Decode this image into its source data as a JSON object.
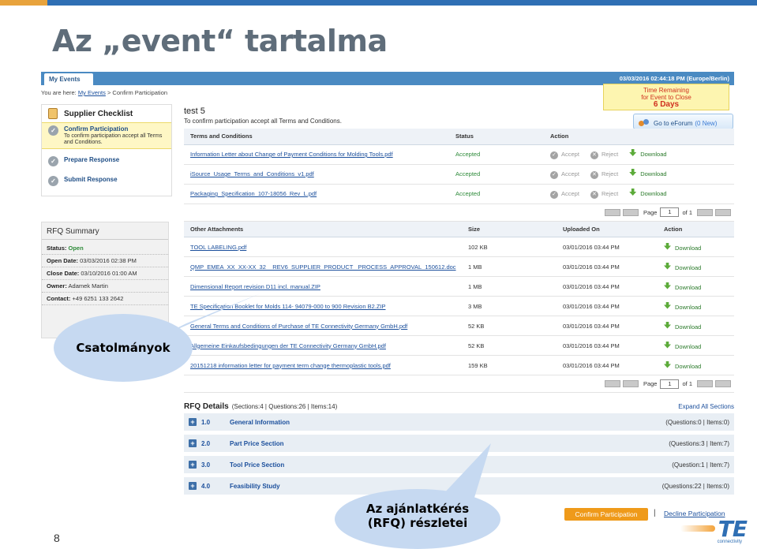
{
  "slide": {
    "title": "Az „event“ tartalma",
    "page_number": "8"
  },
  "nav": {
    "tab": "My Events",
    "datetime": "03/03/2016 02:44:18 PM (Europe/Berlin)"
  },
  "breadcrumb": {
    "prefix": "You are here:",
    "link": "My Events",
    "current": "> Confirm Participation"
  },
  "time_remaining": {
    "line1": "Time Remaining",
    "line2": "for Event to Close",
    "days": "6 Days"
  },
  "eforum": {
    "label": "Go to eForum",
    "count": "(0 New)"
  },
  "checklist": {
    "title": "Supplier Checklist",
    "items": [
      {
        "label": "Confirm Participation",
        "desc": "To confirm participation accept all Terms and Conditions."
      },
      {
        "label": "Prepare Response"
      },
      {
        "label": "Submit Response"
      }
    ]
  },
  "rfq_summary": {
    "title": "RFQ Summary",
    "status_label": "Status:",
    "status_value": "Open",
    "open_label": "Open Date:",
    "open_value": "03/03/2016 02:38 PM",
    "close_label": "Close Date:",
    "close_value": "03/10/2016 01:00 AM",
    "owner_label": "Owner:",
    "owner_value": "Adamek Martin",
    "contact_label": "Contact:",
    "contact_value": "+49 6251 133 2642"
  },
  "event": {
    "title": "test 5",
    "subtitle": "To confirm participation accept all Terms and Conditions."
  },
  "terms_table": {
    "headers": [
      "Terms and Conditions",
      "Status",
      "Action"
    ],
    "rows": [
      {
        "name": "Information Letter about Change of Payment Conditions for Molding Tools.pdf",
        "status": "Accepted"
      },
      {
        "name": "iSource_Usage_Terms_and_Conditions_v1.pdf",
        "status": "Accepted"
      },
      {
        "name": "Packaging_Specification_107-18056_Rev_L.pdf",
        "status": "Accepted"
      }
    ],
    "accept": "Accept",
    "reject": "Reject",
    "download": "Download"
  },
  "pager": {
    "label": "Page",
    "value": "1",
    "of": "of 1"
  },
  "attachments": {
    "headers": [
      "Other Attachments",
      "Size",
      "Uploaded On",
      "Action"
    ],
    "rows": [
      {
        "name": "TOOL LABELING.pdf",
        "size": "102 KB",
        "date": "03/01/2016 03:44 PM"
      },
      {
        "name": "QMP_EMEA_XX_XX-XX_32__REV6_SUPPLIER_PRODUCT _PROCESS_APPROVAL_150612.doc",
        "size": "1 MB",
        "date": "03/01/2016 03:44 PM"
      },
      {
        "name": "Dimensional Report revision D11 incl. manual.ZIP",
        "size": "1 MB",
        "date": "03/01/2016 03:44 PM"
      },
      {
        "name": "TE Specification Booklet for Molds 114- 94079-000 to 900 Revision B2.ZIP",
        "size": "3 MB",
        "date": "03/01/2016 03:44 PM"
      },
      {
        "name": "General Terms and Conditions of Purchase of TE Connectivity Germany GmbH.pdf",
        "size": "52 KB",
        "date": "03/01/2016 03:44 PM"
      },
      {
        "name": "Allgemeine Einkaufsbedingungen der TE Connectivity Germany GmbH.pdf",
        "size": "52 KB",
        "date": "03/01/2016 03:44 PM"
      },
      {
        "name": "20151218 information letter for payment term change thermoplastic tools.pdf",
        "size": "159 KB",
        "date": "03/01/2016 03:44 PM"
      }
    ],
    "download": "Download"
  },
  "rfq_details": {
    "title": "RFQ Details",
    "summary": "(Sections:4 | Questions:26 | Items:14)",
    "expand": "Expand All Sections",
    "sections": [
      {
        "num": "1.0",
        "name": "General Information",
        "counts": "(Questions:0 | Items:0)"
      },
      {
        "num": "2.0",
        "name": "Part Price Section",
        "counts": "(Questions:3 | Item:7)"
      },
      {
        "num": "3.0",
        "name": "Tool Price Section",
        "counts": "(Question:1 | Item:7)"
      },
      {
        "num": "4.0",
        "name": "Feasibility Study",
        "counts": "(Questions:22 | Items:0)"
      }
    ]
  },
  "buttons": {
    "confirm": "Confirm Participation",
    "separator": "|",
    "decline": "Decline Participation"
  },
  "callouts": {
    "attachments": "Csatolmányok",
    "rfq_line1": "Az ajánlatkérés",
    "rfq_line2": "(RFQ) részletei"
  },
  "logo": {
    "text": "TE",
    "sub": "connectivity"
  },
  "colors": {
    "accent_orange": "#ef9a1a",
    "nav_blue": "#4a8ac2",
    "accepted_green": "#2e8b3a",
    "callout_bg": "#c6d9f1"
  }
}
